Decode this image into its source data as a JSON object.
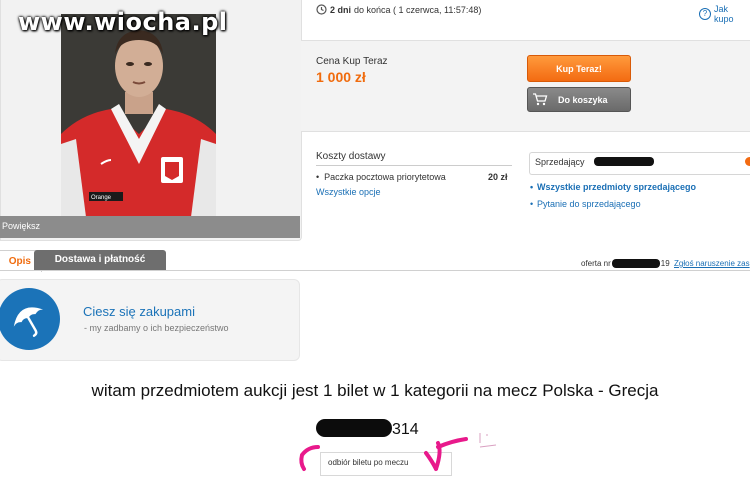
{
  "watermark": "www.wiocha.pl",
  "gallery": {
    "enlarge_label": "Powiększ"
  },
  "auction": {
    "time_left_bold": "2 dni",
    "time_left_rest": "do końca ( 1 czerwca, 11:57:48)",
    "how_to_buy": "Jak kupo",
    "price_label": "Cena Kup Teraz",
    "price": "1 000 zł",
    "buy_now_label": "Kup Teraz!",
    "add_to_cart_label": "Do koszyka"
  },
  "shipping": {
    "title": "Koszty dostawy",
    "method": "Paczka pocztowa priorytetowa",
    "method_price": "20 zł",
    "all_options": "Wszystkie opcje"
  },
  "seller": {
    "label": "Sprzedający",
    "all_items": "Wszystkie przedmioty sprzedającego",
    "ask_seller": "Pytanie do sprzedającego"
  },
  "tabs": [
    {
      "label": "Opis"
    },
    {
      "label": "Dostawa i płatność"
    }
  ],
  "offer": {
    "prefix": "oferta nr",
    "suffix": "19",
    "report": "Zgłoś naruszenie zas"
  },
  "safety_banner": {
    "title": "Ciesz się zakupami",
    "subtitle": "- my zadbamy o ich bezpieczeństwo"
  },
  "description": {
    "text": "witam przedmiotem aukcji jest 1 bilet w 1 kategorii na mecz Polska - Grecja",
    "number_suffix": "314",
    "pickup_note": "odbiór biletu po meczu"
  },
  "colors": {
    "accent_orange": "#f06b0d",
    "link_blue": "#1a6fb5",
    "button_gray": "#6e6e6e"
  }
}
